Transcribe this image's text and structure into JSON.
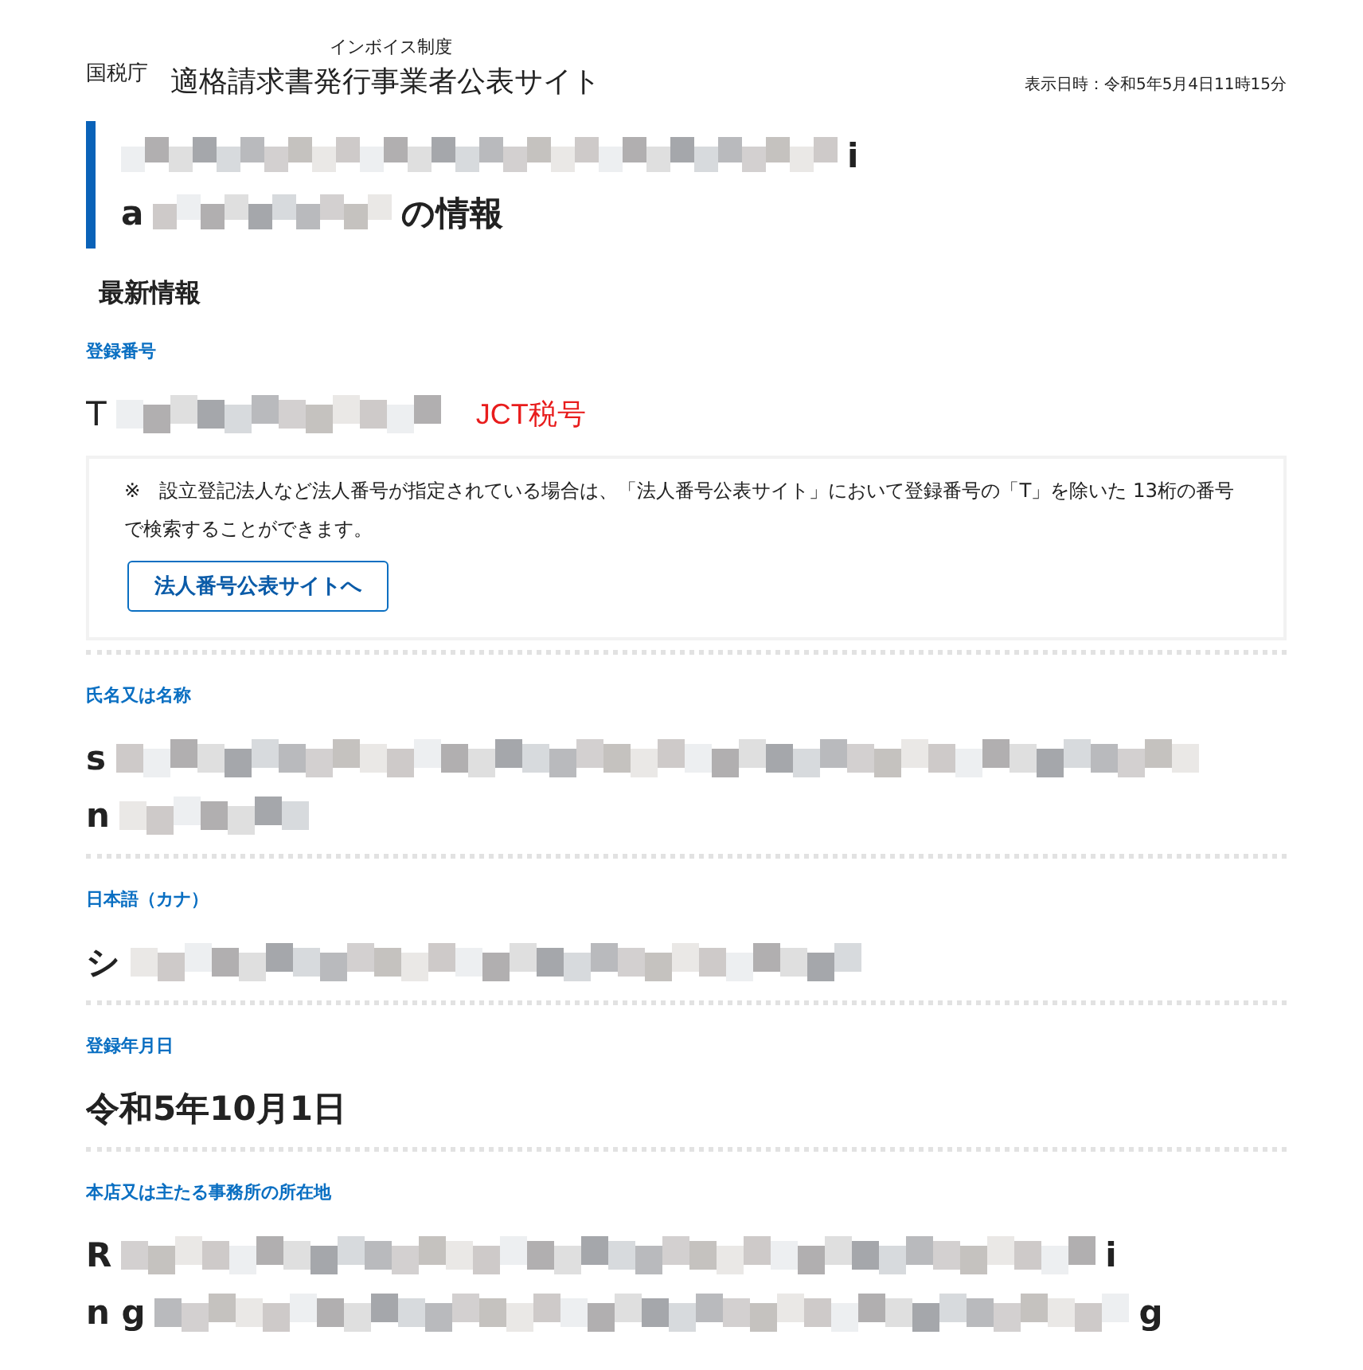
{
  "header": {
    "agency": "国税庁",
    "subtitle": "インボイス制度",
    "site_title": "適格請求書発行事業者公表サイト",
    "display_time": "表示日時：令和5年5月4日11時15分"
  },
  "title": {
    "lines": [
      [
        {
          "kind": "mosaic"
        },
        {
          "kind": "text",
          "text": "i"
        }
      ],
      [
        {
          "kind": "text",
          "text": "a"
        },
        {
          "kind": "mosaic"
        },
        {
          "kind": "text",
          "text": "の情報"
        }
      ]
    ]
  },
  "section_heading": "最新情報",
  "fields": [
    {
      "kind": "number",
      "label": "登録番号",
      "lines": [
        [
          {
            "kind": "text",
            "text": "T"
          },
          {
            "kind": "mosaic"
          }
        ]
      ],
      "annotation": "JCT税号",
      "note": {
        "text": "※　設立登記法人など法人番号が指定されている場合は、「法人番号公表サイト」において登録番号の「T」を除いた 13桁の番号で検索することができます。",
        "button": "法人番号公表サイトへ"
      }
    },
    {
      "kind": "value",
      "label": "氏名又は名称",
      "lines": [
        [
          {
            "kind": "text",
            "text": "s"
          },
          {
            "kind": "mosaic"
          }
        ],
        [
          {
            "kind": "text",
            "text": "n"
          },
          {
            "kind": "mosaic"
          }
        ]
      ]
    },
    {
      "kind": "value",
      "label": "日本語（カナ）",
      "lines": [
        [
          {
            "kind": "text",
            "text": "シ"
          },
          {
            "kind": "mosaic"
          }
        ]
      ]
    },
    {
      "kind": "value",
      "label": "登録年月日",
      "lines": [
        [
          {
            "kind": "text",
            "text": "令和5年10月1日"
          }
        ]
      ]
    },
    {
      "kind": "value",
      "label": "本店又は主たる事務所の所在地",
      "lines": [
        [
          {
            "kind": "text",
            "text": "R"
          },
          {
            "kind": "mosaic"
          },
          {
            "kind": "text",
            "text": "i"
          }
        ],
        [
          {
            "kind": "text",
            "text": "n g"
          },
          {
            "kind": "mosaic"
          },
          {
            "kind": "text",
            "text": "g"
          }
        ]
      ]
    }
  ]
}
